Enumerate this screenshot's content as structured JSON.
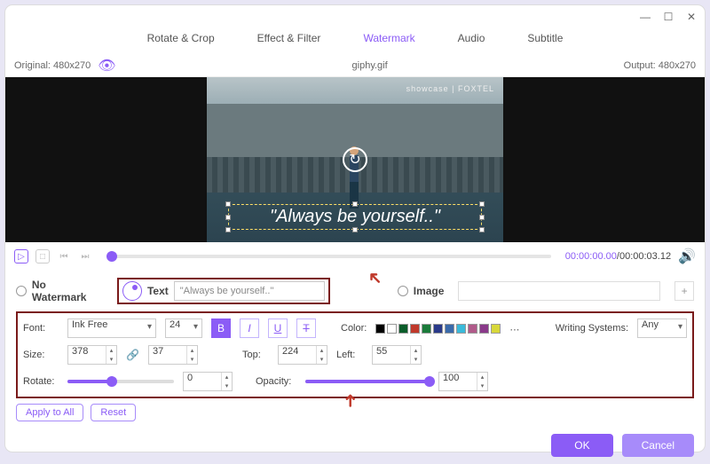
{
  "titlebar": {
    "min": "—",
    "max": "☐",
    "close": "✕"
  },
  "tabs": [
    "Rotate & Crop",
    "Effect & Filter",
    "Watermark",
    "Audio",
    "Subtitle"
  ],
  "active_tab": 2,
  "meta": {
    "original": "Original: 480x270",
    "filename": "giphy.gif",
    "output": "Output: 480x270"
  },
  "preview": {
    "logo": "showcase | FOXTEL",
    "watermark_text": "\"Always be yourself..\""
  },
  "time": {
    "current": "00:00:00.00",
    "total": "00:00:03.12"
  },
  "watermark": {
    "none_label": "No Watermark",
    "text_label": "Text",
    "text_value": "\"Always be yourself..\"",
    "image_label": "Image"
  },
  "props": {
    "font_label": "Font:",
    "font_value": "Ink Free",
    "font_size": "24",
    "color_label": "Color:",
    "colors": [
      "#000000",
      "#ffffff",
      "#0a5c2a",
      "#c0392b",
      "#1a7a3a",
      "#2a3a8a",
      "#3a6aaa",
      "#3abada",
      "#b05a8a",
      "#8a3a8a",
      "#d8d83a"
    ],
    "ws_label": "Writing Systems:",
    "ws_value": "Any",
    "size_label": "Size:",
    "size_w": "378",
    "size_h": "37",
    "top_label": "Top:",
    "top_val": "224",
    "left_label": "Left:",
    "left_val": "55",
    "rotate_label": "Rotate:",
    "rotate_val": "0",
    "rotate_pct": 42,
    "opacity_label": "Opacity:",
    "opacity_val": "100",
    "opacity_pct": 100
  },
  "actions": {
    "apply": "Apply to All",
    "reset": "Reset"
  },
  "footer": {
    "ok": "OK",
    "cancel": "Cancel"
  }
}
